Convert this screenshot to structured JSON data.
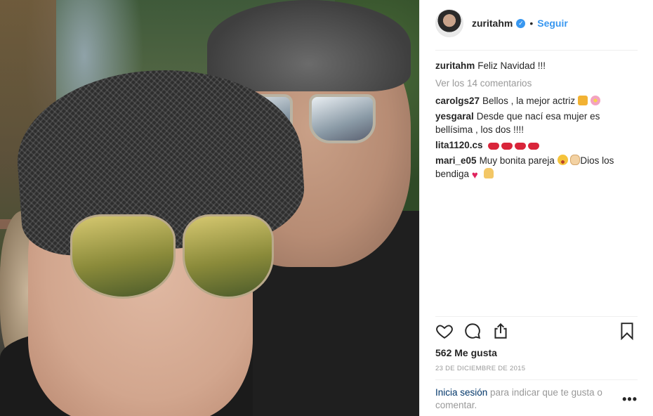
{
  "post": {
    "username": "zuritahm",
    "follow_label": "Seguir",
    "separator": "•",
    "verified_mark": "✓"
  },
  "caption": {
    "username": "zuritahm",
    "text": "Feliz Navidad !!!"
  },
  "view_all_comments": "Ver los 14 comentarios",
  "comments": [
    {
      "username": "carolgs27",
      "text": "Bellos , la mejor actriz",
      "emojis": [
        "thumbs-up-icon",
        "flower-icon"
      ]
    },
    {
      "username": "yesgaral",
      "text": "Desde que nací esa mujer es bellísima , los dos !!!!",
      "emojis": []
    },
    {
      "username": "lita1120.cs",
      "text": "",
      "emojis": [
        "lips-icon",
        "lips-icon",
        "lips-icon",
        "lips-icon"
      ]
    },
    {
      "username": "mari_e05",
      "text": "Muy bonita pareja",
      "text2": "Dios los bendiga",
      "emojis": [
        "heart-eyes-icon",
        "clap-icon",
        "heart-icon",
        "pray-icon"
      ]
    }
  ],
  "likes": "562 Me gusta",
  "date": "23 DE DICIEMBRE DE 2015",
  "login_prompt": {
    "link": "Inicia sesión",
    "text": " para indicar que te gusta o comentar."
  },
  "more_options": "•••",
  "icons": {
    "like": "heart-outline-icon",
    "comment": "comment-icon",
    "share": "share-icon",
    "save": "bookmark-icon"
  },
  "colors": {
    "accent": "#3897f0",
    "link": "#003569",
    "muted": "#999999"
  }
}
